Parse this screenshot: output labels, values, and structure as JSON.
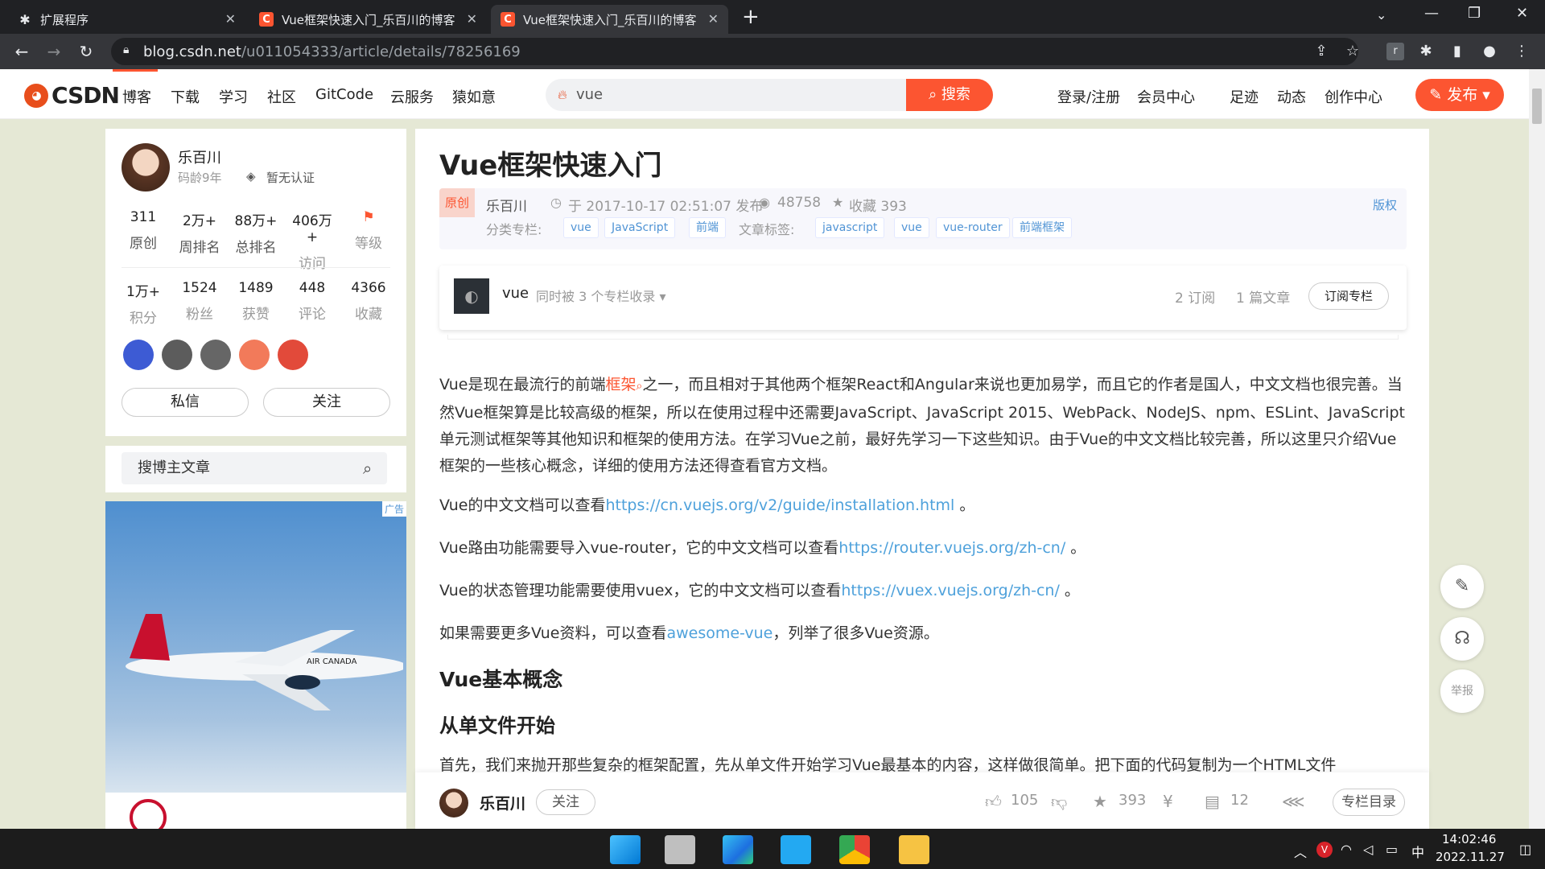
{
  "browser": {
    "tabs": [
      {
        "title": "扩展程序"
      },
      {
        "title": "Vue框架快速入门_乐百川的博客"
      },
      {
        "title": "Vue框架快速入门_乐百川的博客"
      }
    ],
    "url_host": "blog.csdn.net",
    "url_path": "/u011054333/article/details/78256169"
  },
  "csdn_header": {
    "logo": "CSDN",
    "nav": [
      "博客",
      "下载",
      "学习",
      "社区",
      "GitCode",
      "云服务",
      "猿如意"
    ],
    "search_value": "vue",
    "search_button": "搜索",
    "right_nav": [
      "登录/注册",
      "会员中心",
      "足迹",
      "动态",
      "创作中心"
    ],
    "publish": "发布"
  },
  "profile": {
    "name": "乐百川",
    "years": "码龄9年",
    "cert": "暂无认证",
    "stats_row1": [
      {
        "value": "311",
        "label": "原创"
      },
      {
        "value": "2万+",
        "label": "周排名"
      },
      {
        "value": "88万+",
        "label": "总排名"
      },
      {
        "value": "406万+",
        "label": "访问"
      },
      {
        "value": "",
        "label": "等级"
      }
    ],
    "stats_row2": [
      {
        "value": "1万+",
        "label": "积分"
      },
      {
        "value": "1524",
        "label": "粉丝"
      },
      {
        "value": "1489",
        "label": "获赞"
      },
      {
        "value": "448",
        "label": "评论"
      },
      {
        "value": "4366",
        "label": "收藏"
      }
    ],
    "message_button": "私信",
    "follow_button": "关注"
  },
  "blog_search": {
    "placeholder": "搜博主文章"
  },
  "ad": {
    "label": "广告",
    "plane_text": "AIR CANADA"
  },
  "article": {
    "title": "Vue框架快速入门",
    "original_tag": "原创",
    "author": "乐百川",
    "published": "于 2017-10-17 02:51:07 发布",
    "views": "48758",
    "favorites": "收藏 393",
    "copyright": "版权",
    "category_label": "分类专栏:",
    "categories": [
      "vue",
      "JavaScript",
      "前端"
    ],
    "tags_label": "文章标签:",
    "tags": [
      "javascript",
      "vue",
      "vue-router",
      "前端框架"
    ],
    "column": {
      "name": "vue",
      "included": "同时被 3 个专栏收录",
      "subs": "2 订阅",
      "articles": "1 篇文章",
      "subscribe_button": "订阅专栏"
    },
    "p1_a": "Vue是现在最流行的前端",
    "p1_link": "框架",
    "p1_b": "之一，而且相对于其他两个框架React和Angular来说也更加易学，而且它的作者是国人，中文文档也很完善。当然Vue框架算是比较高级的框架，所以在使用过程中还需要JavaScript、JavaScript 2015、WebPack、NodeJS、npm、ESLint、JavaScript单元测试框架等其他知识和框架的使用方法。在学习Vue之前，最好先学习一下这些知识。由于Vue的中文文档比较完善，所以这里只介绍Vue框架的一些核心概念，详细的使用方法还得查看官方文档。",
    "p2_a": "Vue的中文文档可以查看",
    "p2_link": "https://cn.vuejs.org/v2/guide/installation.html",
    "p2_b": " 。",
    "p3_a": "Vue路由功能需要导入vue-router，它的中文文档可以查看",
    "p3_link": "https://router.vuejs.org/zh-cn/",
    "p3_b": " 。",
    "p4_a": "Vue的状态管理功能需要使用vuex，它的中文文档可以查看",
    "p4_link": "https://vuex.vuejs.org/zh-cn/",
    "p4_b": " 。",
    "p5_a": "如果需要更多Vue资料，可以查看",
    "p5_link": "awesome-vue",
    "p5_b": "，列举了很多Vue资源。",
    "h2": "Vue基本概念",
    "h3": "从单文件开始",
    "p6": "首先，我们来抛开那些复杂的框架配置，先从单文件开始学习Vue最基本的内容，这样做很简单。把下面的代码复制为一个HTML文件"
  },
  "bottom_bar": {
    "author": "乐百川",
    "follow": "关注",
    "likes": "105",
    "favorites": "393",
    "comments": "12",
    "toc": "专栏目录"
  },
  "float": {
    "report": "举报"
  },
  "taskbar": {
    "time": "14:02:46",
    "date": "2022.11.27",
    "ime": "中"
  }
}
